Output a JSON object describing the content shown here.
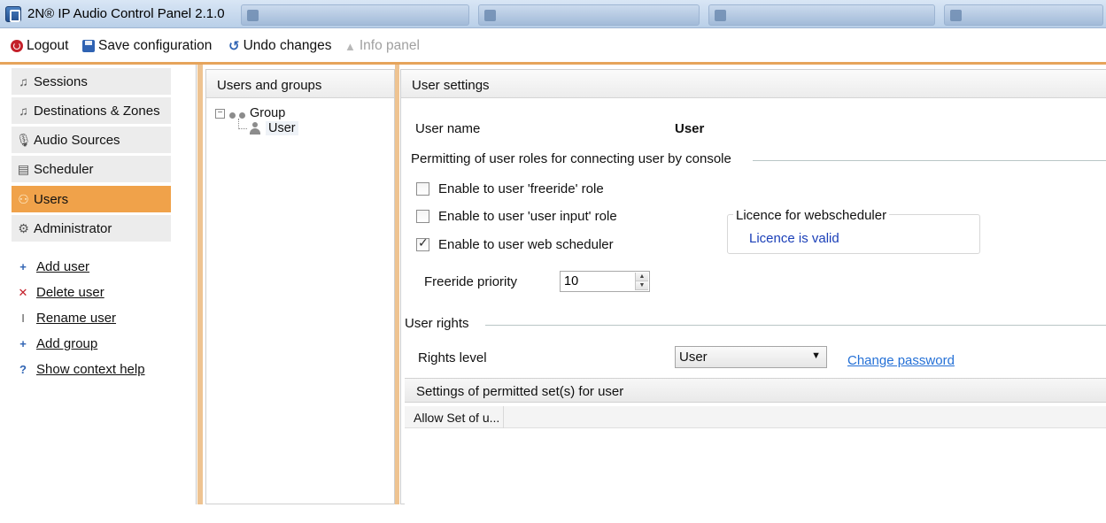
{
  "window": {
    "title": "2N® IP Audio Control Panel 2.1.0"
  },
  "toolbar": {
    "logout": "Logout",
    "save": "Save configuration",
    "undo": "Undo changes",
    "info": "Info panel"
  },
  "sidebar": {
    "items": [
      {
        "label": "Sessions",
        "icon": "music-note-icon"
      },
      {
        "label": "Destinations & Zones",
        "icon": "music-note-icon"
      },
      {
        "label": "Audio Sources",
        "icon": "microphone-icon"
      },
      {
        "label": "Scheduler",
        "icon": "calendar-icon"
      },
      {
        "label": "Users",
        "icon": "users-icon",
        "active": true
      },
      {
        "label": "Administrator",
        "icon": "gear-icon"
      }
    ],
    "actions": [
      {
        "label": "Add user",
        "icon": "add-user-icon"
      },
      {
        "label": "Delete user",
        "icon": "delete-user-icon"
      },
      {
        "label": "Rename user",
        "icon": "rename-icon"
      },
      {
        "label": "Add group",
        "icon": "add-group-icon"
      },
      {
        "label": "Show context help",
        "icon": "help-icon"
      }
    ]
  },
  "users_groups": {
    "title": "Users and groups",
    "tree": {
      "group": "Group",
      "user": "User"
    }
  },
  "settings": {
    "title": "User settings",
    "user_name_label": "User name",
    "user_name_value": "User",
    "roles_section": "Permitting of user roles for connecting user by console",
    "checkboxes": [
      {
        "label": "Enable to user 'freeride' role",
        "checked": false
      },
      {
        "label": "Enable to user 'user input' role",
        "checked": false
      },
      {
        "label": "Enable to user web scheduler",
        "checked": true
      }
    ],
    "licence": {
      "legend": "Licence for webscheduler",
      "status": "Licence is valid"
    },
    "freeride_priority_label": "Freeride priority",
    "freeride_priority_value": "10",
    "rights_section": "User rights",
    "rights_level_label": "Rights level",
    "rights_level_value": "User",
    "change_password": "Change password",
    "permitted_sets_title": "Settings of permitted set(s) for user",
    "grid_column": "Allow Set of u..."
  },
  "colors": {
    "accent": "#f0a24a",
    "link": "#2470d6",
    "licence_text": "#1a3fb8"
  }
}
